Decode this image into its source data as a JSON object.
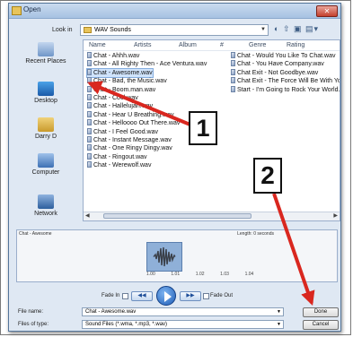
{
  "window": {
    "title": "Open",
    "close_glyph": "✕"
  },
  "look_in": {
    "label": "Look in",
    "value": "WAV Sounds"
  },
  "places": [
    {
      "label": "Recent Places",
      "icon": "recent-places-icon"
    },
    {
      "label": "Desktop",
      "icon": "desktop-icon"
    },
    {
      "label": "Darry D",
      "icon": "user-folder-icon"
    },
    {
      "label": "Computer",
      "icon": "computer-icon"
    },
    {
      "label": "Network",
      "icon": "network-icon"
    }
  ],
  "columns": [
    "Name",
    "Artists",
    "Album",
    "#",
    "Genre",
    "Rating"
  ],
  "files_col1": [
    "Chat - Ahhh.wav",
    "Chat - All Righty Then - Ace Ventura.wav",
    "Chat - Awesome.wav",
    "Chat - Bad, the Music.wav",
    "Chat - Boom.man.wav",
    "Chat - Cool.wav",
    "Chat - Hallelujah.wav",
    "Chat - Hear U Breathing.wav",
    "Chat - Helloooo Out There.wav",
    "Chat - I Feel Good.wav",
    "Chat - Instant Message.wav",
    "Chat - One Ringy Dingy.wav",
    "Chat - Ringout.wav",
    "Chat - Werewolf.wav"
  ],
  "files_col2": [
    "Chat - Would You Like To Chat.wav",
    "Chat - You Have Company.wav",
    "Chat Exit - Not Goodbye.wav",
    "Chat Exit - The Force Will Be With You.wav",
    "Start - I'm Going to Rock Your World.wav"
  ],
  "selected_file": "Chat - Awesome.wav",
  "preview": {
    "caption": "Chat - Awesome",
    "length_label": "Length: 0 seconds",
    "ticks": [
      "1.00",
      "1.01",
      "1.02",
      "1.03",
      "1.04"
    ]
  },
  "transport": {
    "fade_in_label": "Fade In",
    "fade_out_label": "Fade Out",
    "rewind_glyph": "◀◀",
    "forward_glyph": "▶▶"
  },
  "file_name": {
    "label": "File name:",
    "value": "Chat - Awesome.wav"
  },
  "file_type": {
    "label": "Files of type:",
    "value": "Sound Files (*.wma, *.mp3, *.wav)"
  },
  "buttons": {
    "done": "Done",
    "cancel": "Cancel"
  },
  "callouts": [
    "1",
    "2"
  ],
  "colors": {
    "arrow": "#d9271f",
    "selection": "#cfe3fb",
    "play": "#1e5cb6"
  }
}
